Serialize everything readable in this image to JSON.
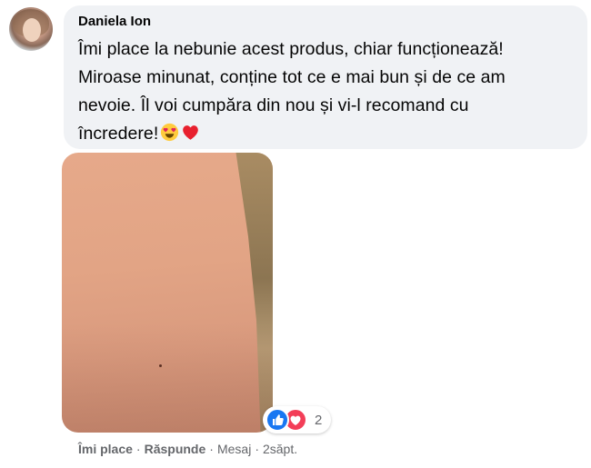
{
  "comment": {
    "author": "Daniela Ion",
    "lines": [
      "Îmi place la nebunie acest produs, chiar funcționează!",
      "Miroase minunat, conține tot ce e mai bun și de ce am",
      "nevoie. Îl voi cumpăra din nou și vi-l recomand cu",
      "încredere!"
    ],
    "emojis": [
      "heart-eyes-emoji",
      "red-heart-emoji"
    ]
  },
  "reactions": {
    "icons": [
      "like-icon",
      "love-icon"
    ],
    "count": "2"
  },
  "actions": {
    "like_label": "Îmi place",
    "reply_label": "Răspunde",
    "message_label": "Mesaj",
    "time_label": "2săpt.",
    "separator": "·"
  },
  "colors": {
    "bubble_bg": "#f0f2f5",
    "like_blue": "#1877f2",
    "love_red": "#f33e58",
    "muted_text": "#65676b"
  }
}
